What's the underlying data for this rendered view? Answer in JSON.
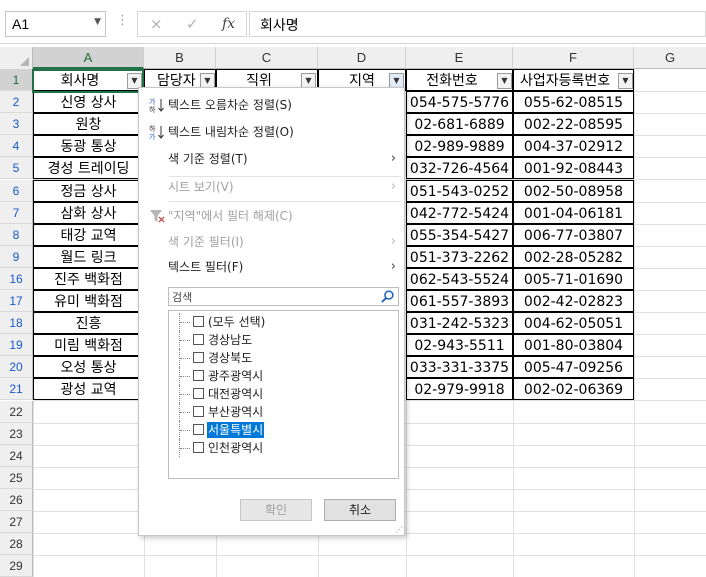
{
  "formula_bar": {
    "name_box": "A1",
    "dots": "⋮",
    "cancel_icon": "×",
    "enter_icon": "✓",
    "fx_label": "fx",
    "content": "회사명"
  },
  "columns": [
    "A",
    "B",
    "C",
    "D",
    "E",
    "F",
    "G"
  ],
  "row_numbers": [
    "1",
    "2",
    "3",
    "4",
    "5",
    "6",
    "7",
    "8",
    "9",
    "16",
    "17",
    "18",
    "19",
    "20",
    "21",
    "22",
    "23",
    "24",
    "25",
    "26",
    "27",
    "28",
    "29"
  ],
  "headers": {
    "A": "회사명",
    "B": "담당자",
    "C": "직위",
    "D": "지역",
    "E": "전화번호",
    "F": "사업자등록번호"
  },
  "company_names": [
    "신영 상사",
    "원창",
    "동광 통상",
    "경성 트레이딩",
    "정금 상사",
    "삼화 상사",
    "태강 교역",
    "월드 링크",
    "진주 백화점",
    "유미 백화점",
    "진흥",
    "미림 백화점",
    "오성 통상",
    "광성 교역"
  ],
  "phones": [
    "054-575-5776",
    "02-681-6889",
    "02-989-9889",
    "032-726-4564",
    "051-543-0252",
    "042-772-5424",
    "055-354-5427",
    "051-373-2262",
    "062-543-5524",
    "061-557-3893",
    "031-242-5323",
    "02-943-5511",
    "033-331-3375",
    "02-979-9918"
  ],
  "biz_numbers": [
    "055-62-08515",
    "002-22-08595",
    "004-37-02912",
    "001-92-08443",
    "002-50-08958",
    "001-04-06181",
    "006-77-03807",
    "002-28-05282",
    "005-71-01690",
    "002-42-02823",
    "004-62-05051",
    "001-80-03804",
    "005-47-09256",
    "002-02-06369"
  ],
  "filter_menu": {
    "sort_asc": "텍스트 오름차순 정렬(S)",
    "sort_desc": "텍스트 내림차순 정렬(O)",
    "sort_by_color": "색 기준 정렬(T)",
    "sheet_view": "시트 보기(V)",
    "clear_filter": "\"지역\"에서 필터 해제(C)",
    "filter_by_color": "색 기준 필터(I)",
    "text_filters": "텍스트 필터(F)",
    "search_placeholder": "검색",
    "items": [
      {
        "label": "(모두 선택)",
        "checked": false
      },
      {
        "label": "경상남도",
        "checked": false
      },
      {
        "label": "경상북도",
        "checked": false
      },
      {
        "label": "광주광역시",
        "checked": false
      },
      {
        "label": "대전광역시",
        "checked": false
      },
      {
        "label": "부산광역시",
        "checked": false
      },
      {
        "label": "서울특별시",
        "checked": false
      },
      {
        "label": "인천광역시",
        "checked": false
      }
    ],
    "ok": "확인",
    "cancel": "취소"
  },
  "colors": {
    "accent": "#217346",
    "selection_blue": "#0078d7",
    "filtered_row_number": "#1a57c9"
  }
}
